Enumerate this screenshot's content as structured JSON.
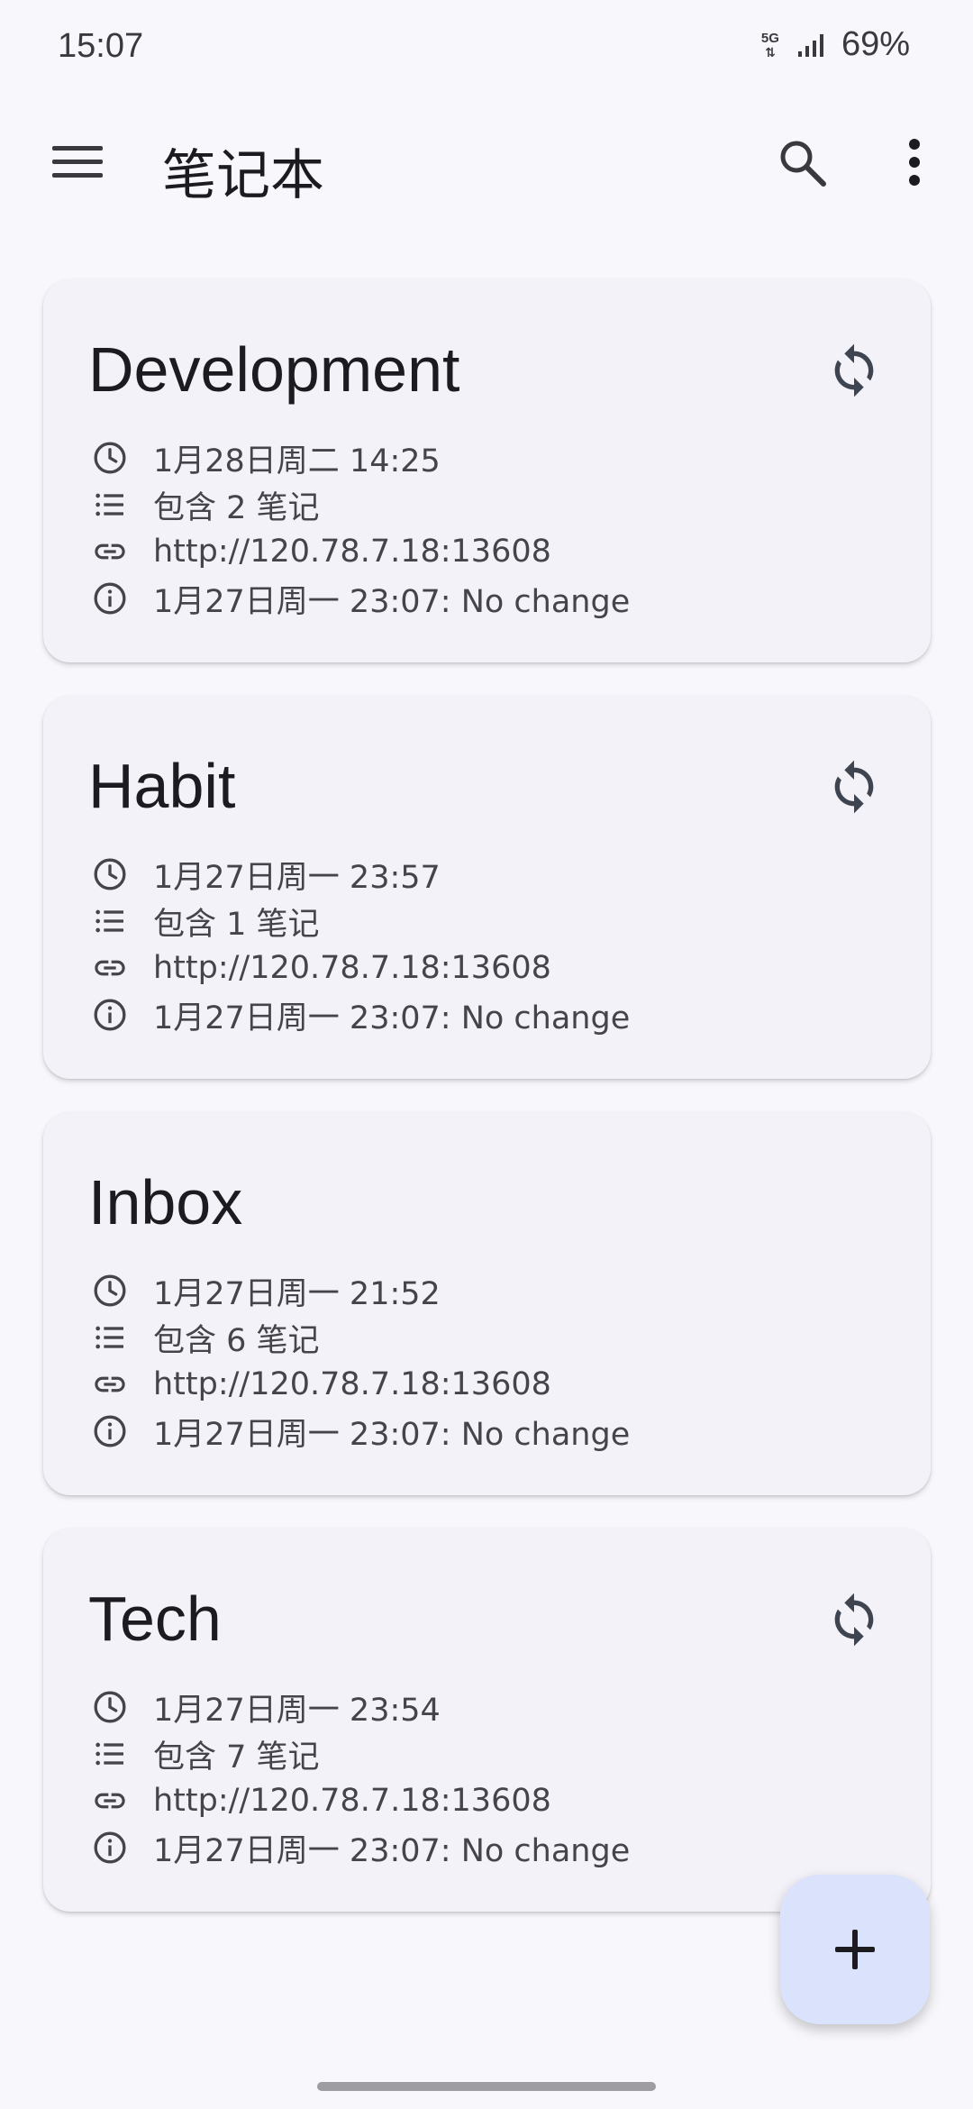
{
  "status_bar": {
    "time": "15:07",
    "network": "5G",
    "battery": "69%"
  },
  "app_bar": {
    "title": "笔记本",
    "menu_icon": "menu-icon",
    "search_icon": "search-icon",
    "more_icon": "more-vert-icon"
  },
  "notebooks": [
    {
      "name": "Development",
      "modified": "1月28日周二 14:25",
      "notes": "包含 2 笔记",
      "url": "http://120.78.7.18:13608",
      "sync_status": "1月27日周一 23:07: No change",
      "has_sync": true
    },
    {
      "name": "Habit",
      "modified": "1月27日周一 23:57",
      "notes": "包含 1 笔记",
      "url": "http://120.78.7.18:13608",
      "sync_status": "1月27日周一 23:07: No change",
      "has_sync": true
    },
    {
      "name": "Inbox",
      "modified": "1月27日周一 21:52",
      "notes": "包含 6 笔记",
      "url": "http://120.78.7.18:13608",
      "sync_status": "1月27日周一 23:07: No change",
      "has_sync": false
    },
    {
      "name": "Tech",
      "modified": "1月27日周一 23:54",
      "notes": "包含 7 笔记",
      "url": "http://120.78.7.18:13608",
      "sync_status": "1月27日周一 23:07: No change",
      "has_sync": true
    }
  ],
  "fab": {
    "icon": "add-icon"
  },
  "colors": {
    "background": "#f8f8fc",
    "card": "#f3f2f8",
    "fab": "#dbe2fb",
    "text": "#1c1b1f"
  }
}
